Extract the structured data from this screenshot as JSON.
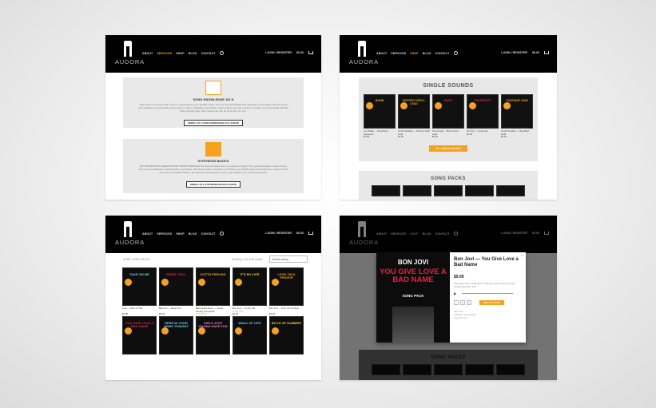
{
  "header": {
    "logo_text": "AUDORA",
    "nav": [
      "ABOUT",
      "SERVICES",
      "SHOP",
      "BLOG",
      "CONTACT"
    ],
    "login": "LOGIN / REGISTER",
    "cart": "$0.00"
  },
  "services": [
    {
      "title": "SONG KNOWLEDGE 101'S",
      "text": "This course is a \"Know-101\" course, customized to your specific needs. If you're not comfortable with sampling or can't figure out how to get your samples to work exactly as the lesson, want to integrate a new library, want to figure out how to set up a vocals, or just generally take the first & primary step, this is where we can do all of them for you.",
      "button": "ENROLL IN A SONG KNOWLEDGE 101 LESSON"
    },
    {
      "title": "SYNTHESIS BASICS",
      "text": "SOY BOMP BOOP SWEEP ZWORP WAZZ? BWWWAH! Do these phrases seem completely foreign? The synthesis basics course aims to help cover the absolute fundamentals of synthesis. We discuss what a waveform is! What is your ADSR mode and what does it mean to LFO and other controllable factors. We discuss everything you need to get started in the world of synthesis.",
      "button": "ENROLL IN A SYNTHESIS BASICS LESSON"
    }
  ],
  "single_sounds": {
    "title": "SINGLE SOUNDS",
    "items": [
      {
        "art": "BOMB",
        "title": "Joe Walsh — Rock Bass Sequence",
        "price": "$0.99",
        "color": "#f7a21b"
      },
      {
        "art": "DESTROY SPELL LEAD",
        "title": "Jordan Rudess — Destroy Spell Lead",
        "price": "$1.99",
        "color": "#f7a21b"
      },
      {
        "art": "BASS",
        "title": "Five Finger — Blues Arrow Lead",
        "price": "$0.99",
        "color": "#e5213f"
      },
      {
        "art": "FRATERNITY",
        "title": "Our Key — Fraternity",
        "price": "$1.99",
        "color": "#e5213f"
      },
      {
        "art": "CONTINUE LEAD",
        "title": "Jordan Rudess — Woodhart Lead",
        "price": "$0.99",
        "color": "#f7a21b"
      }
    ],
    "button": "ALL SINGLE SOUNDS"
  },
  "song_packs_title": "SONG PACKS",
  "shop": {
    "breadcrumb": "HOME / SONG PACKS",
    "showing": "Showing 1–16 of 39 results",
    "sorting": "Default sorting",
    "products": [
      {
        "art": "TAKE ON ME",
        "name": "a-ha — Take On Me",
        "price": "$9.99",
        "color": "#6ad1f0",
        "stars": ""
      },
      {
        "art": "REBEL YELL",
        "name": "Billy Idol — Rebel Yell",
        "price": "$9.99",
        "color": "#e5213f",
        "stars": ""
      },
      {
        "art": "GOTTA FEELING",
        "name": "Black Eyed Peas — I Gotta Feeling Song Pack",
        "price": "$9.99",
        "color": "#f7a21b",
        "stars": "★★★★★"
      },
      {
        "art": "IT'S MY LIFE",
        "name": "Bon Jovi — It's My Life",
        "price": "$9.99",
        "color": "#f5d020",
        "stars": "★★★★★"
      },
      {
        "art": "LIVIN' ON A PRAYER",
        "name": "Bon Jovi — Livin' On A Prayer",
        "price": "$9.99",
        "color": "#f7a21b",
        "stars": ""
      },
      {
        "art": "YOU GIVE LOVE A BAD NAME",
        "name": "",
        "price": "",
        "color": "#e5213f",
        "stars": ""
      },
      {
        "art": "HERE IN YOUR ARMS TONIGHT",
        "name": "",
        "price": "",
        "color": "#6ad1f0",
        "stars": ""
      },
      {
        "art": "GIRLS JUST WANNA HAVE FUN",
        "name": "",
        "price": "",
        "color": "#e57bd0",
        "stars": ""
      },
      {
        "art": "WALK OF LIFE",
        "name": "",
        "price": "",
        "color": "#6ad1f0",
        "stars": ""
      },
      {
        "art": "BOYS OF SUMMER",
        "name": "",
        "price": "",
        "color": "#f5d020",
        "stars": ""
      }
    ]
  },
  "modal": {
    "art_top": "BON JOVI",
    "art_title": "YOU GIVE LOVE A BAD NAME",
    "art_sub": "SONG PACK",
    "title": "Bon Jovi — You Give Love a Bad Name",
    "price": "$9.99",
    "desc": "Who gave love a bad name? We got every song the song sounds like Bon Jovi!",
    "add": "ADD TO CART",
    "qty": "1",
    "sku": "SKU: N/A",
    "category": "Category: Song Packs",
    "tag": "Tag: Bon Jovi",
    "close": "×"
  },
  "colors": {
    "accent": "#f7a21b",
    "header_bg": "#000000"
  }
}
